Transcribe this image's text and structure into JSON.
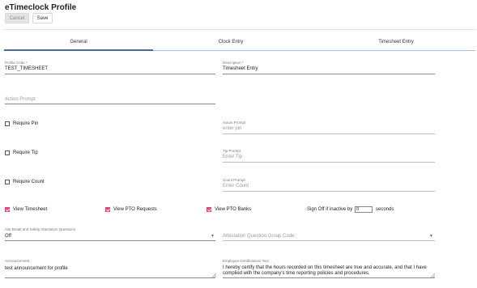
{
  "header": {
    "title": "eTimeclock Profile",
    "cancel_label": "Cancel",
    "save_label": "Save"
  },
  "tabs": [
    {
      "label": "General",
      "active": true
    },
    {
      "label": "Clock Entry",
      "active": false
    },
    {
      "label": "Timesheet Entry",
      "active": false
    }
  ],
  "form": {
    "profile_code": {
      "label": "Profile Code *",
      "value": "TEST_TIMESHEET"
    },
    "description": {
      "label": "Description *",
      "value": "Timesheet Entry"
    },
    "action_prompt_main": {
      "placeholder": "Action Prompt"
    },
    "require_pin": {
      "label": "Require Pin",
      "checked": false
    },
    "require_tip": {
      "label": "Require Tip",
      "checked": false
    },
    "require_count": {
      "label": "Require Count",
      "checked": false
    },
    "action_prompt": {
      "label": "Action Prompt",
      "placeholder": "enter pin"
    },
    "tip_prompt": {
      "label": "Tip Prompt",
      "placeholder": "Enter Tip"
    },
    "count_prompt": {
      "label": "Count Prompt",
      "placeholder": "Enter Count"
    },
    "view_timesheet": {
      "label": "View Timesheet",
      "checked": true
    },
    "view_pto_requests": {
      "label": "View PTO Requests",
      "checked": true
    },
    "view_pto_banks": {
      "label": "View PTO Banks",
      "checked": true
    },
    "sign_off": {
      "label": "Sign Off if inactive by",
      "value": "0",
      "unit": "seconds"
    },
    "ask_break": {
      "label": "Ask Break and Safety Attestation Questions",
      "value": "Off"
    },
    "attestation_group": {
      "placeholder": "Attestation Question Group Code:"
    },
    "announcement": {
      "label": "Announcement",
      "value": "test announcement for profile"
    },
    "certification": {
      "label": "Employee Certifications Text",
      "line1": "I hereby certify that the hours recorded on this timesheet are true and accurate, and that I have",
      "line2": "complied with the company's time reporting policies and procedures."
    }
  }
}
